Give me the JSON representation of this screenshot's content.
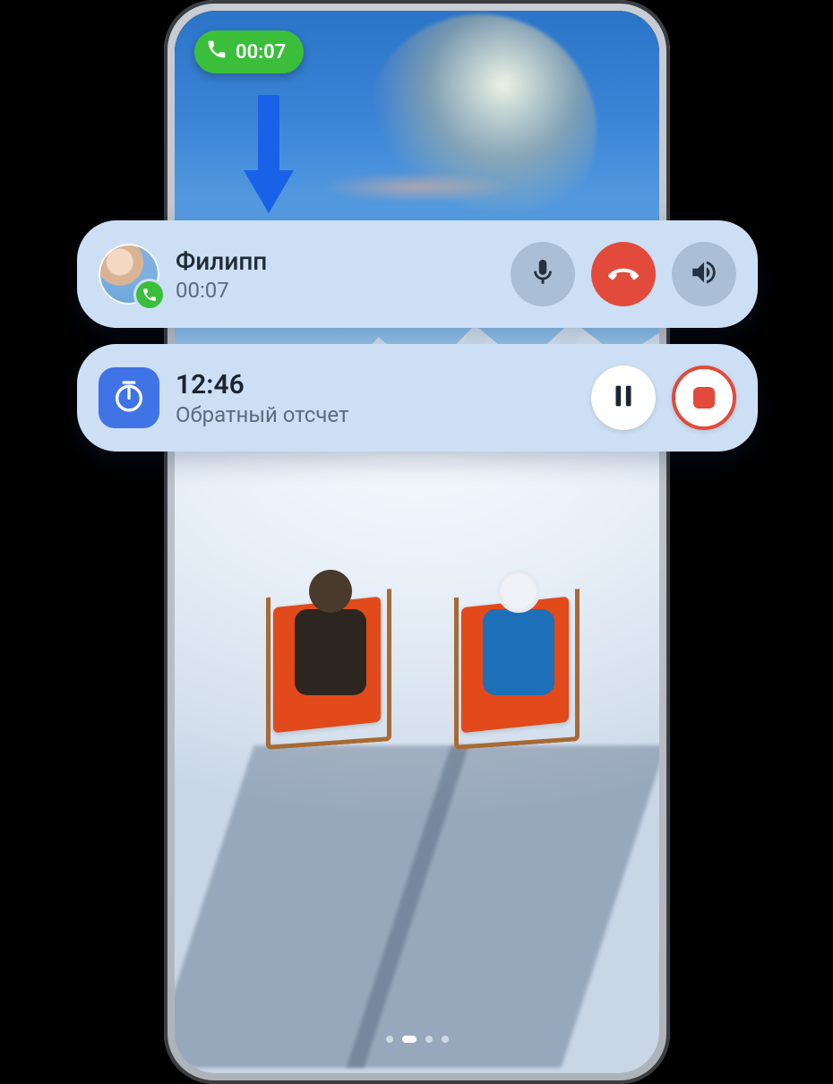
{
  "status_pill": {
    "icon": "phone-icon",
    "duration": "00:07"
  },
  "annotation_arrow": {
    "color": "#1962e8"
  },
  "call_notification": {
    "caller_name": "Филипп",
    "duration": "00:07",
    "avatar_badge_icon": "phone-icon",
    "buttons": {
      "mute_icon": "mic-icon",
      "hangup_icon": "phone-down-icon",
      "speaker_icon": "speaker-icon"
    }
  },
  "timer_notification": {
    "time": "12:46",
    "label": "Обратный отсчет",
    "app_icon": "timer-icon",
    "buttons": {
      "pause_icon": "pause-icon",
      "stop_icon": "stop-icon"
    }
  },
  "colors": {
    "pill_green": "#3bbf3b",
    "hangup_red": "#e24a3b",
    "arrow_blue": "#1962e8",
    "panel_bg": "#cddff4",
    "timer_blue": "#3f73e6"
  }
}
